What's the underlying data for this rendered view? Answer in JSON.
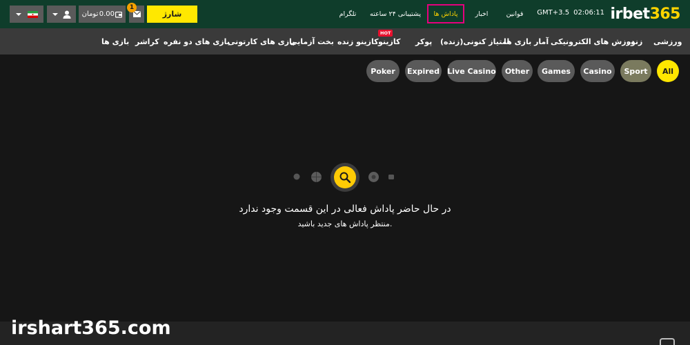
{
  "header": {
    "logo": {
      "part1": "irbet",
      "part2": "365"
    },
    "time": "02:06:11",
    "timezone": "GMT+3.5",
    "nav": [
      {
        "label": "قوانین"
      },
      {
        "label": "اخبار"
      },
      {
        "label": "پاداش ها"
      },
      {
        "label": "پشتیبانی ۲۴ ساعته"
      },
      {
        "label": "تلگرام"
      }
    ],
    "charge_label": "شارژ",
    "notification_count": "1",
    "balance": "0.00",
    "currency": "تومان"
  },
  "categories": [
    {
      "label": "ورزشی"
    },
    {
      "label": "زنده"
    },
    {
      "label": "ورزش های الکترونیکی"
    },
    {
      "label": "آمار بازی ها"
    },
    {
      "label": "امتیاز کنونی(زنده)"
    },
    {
      "label": "پوکر"
    },
    {
      "label": "کازینو"
    },
    {
      "label": "کازینو زنده"
    },
    {
      "label": "بخت آزمایی"
    },
    {
      "label": "بازی های کارتونی"
    },
    {
      "label": "بازی های دو نفره"
    },
    {
      "label": "کراشر"
    },
    {
      "label": "بازی ها"
    }
  ],
  "hot_badge": "HOT",
  "filters": [
    {
      "label": "All"
    },
    {
      "label": "Sport"
    },
    {
      "label": "Casino"
    },
    {
      "label": "Games"
    },
    {
      "label": "Other"
    },
    {
      "label": "Live Casino"
    },
    {
      "label": "Expired"
    },
    {
      "label": "Poker"
    }
  ],
  "empty_state": {
    "title": "در حال حاضر پاداش فعالی در این قسمت وجود ندارد",
    "subtitle": "منتظر پاداش های جدید باشید."
  },
  "watermark": "irshart365.com",
  "colors": {
    "header_bg": "#0f3d2b",
    "accent_yellow": "#ffe800",
    "active_nav_border": "#e6007e",
    "category_bar_bg": "#3a3a3a",
    "page_bg": "#161616"
  }
}
